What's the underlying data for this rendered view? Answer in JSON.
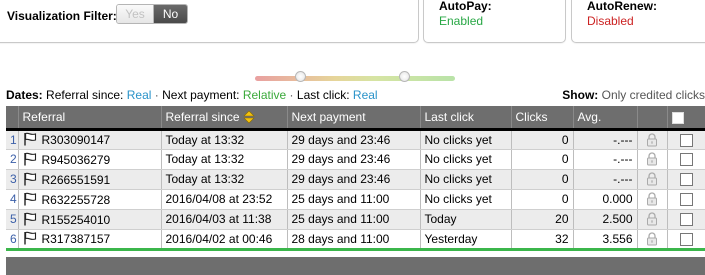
{
  "filter": {
    "label": "Visualization Filter:",
    "yes": "Yes",
    "no": "No",
    "selected": "No"
  },
  "autopay": {
    "title": "AutoPay:",
    "status": "Enabled",
    "color": "#28a745"
  },
  "autorenew": {
    "title": "AutoRenew:",
    "status": "Disabled",
    "color": "#cc2222"
  },
  "info": {
    "dates_label": "Dates:",
    "referral_since_label": "Referral since:",
    "referral_since_value": "Real",
    "next_payment_label": "Next payment:",
    "next_payment_value": "Relative",
    "last_click_label": "Last click:",
    "last_click_value": "Real",
    "sep1": "·",
    "sep2": "·",
    "show_label": "Show:",
    "show_value": "Only credited clicks"
  },
  "table": {
    "headers": [
      "Referral",
      "Referral since",
      "Next payment",
      "Last click",
      "Clicks",
      "Avg."
    ],
    "rows": [
      {
        "n": "1",
        "id": "R303090147",
        "since": "Today at 13:32",
        "next": "29 days and 23:46",
        "last": "No clicks yet",
        "clicks": "0",
        "avg": "-.---"
      },
      {
        "n": "2",
        "id": "R945036279",
        "since": "Today at 13:32",
        "next": "29 days and 23:46",
        "last": "No clicks yet",
        "clicks": "0",
        "avg": "-.---"
      },
      {
        "n": "3",
        "id": "R266551591",
        "since": "Today at 13:32",
        "next": "29 days and 23:46",
        "last": "No clicks yet",
        "clicks": "0",
        "avg": "-.---"
      },
      {
        "n": "4",
        "id": "R632255728",
        "since": "2016/04/08 at 23:52",
        "next": "25 days and 11:00",
        "last": "No clicks yet",
        "clicks": "0",
        "avg": "0.000"
      },
      {
        "n": "5",
        "id": "R155254010",
        "since": "2016/04/03 at 11:38",
        "next": "25 days and 11:00",
        "last": "Today",
        "clicks": "20",
        "avg": "2.500"
      },
      {
        "n": "6",
        "id": "R317387157",
        "since": "2016/04/02 at 00:46",
        "next": "28 days and 11:00",
        "last": "Yesterday",
        "clicks": "32",
        "avg": "3.556"
      }
    ]
  },
  "icons": {
    "flag": "flag-icon",
    "lock": "lock-icon",
    "sort": "sort-arrows-icon"
  }
}
